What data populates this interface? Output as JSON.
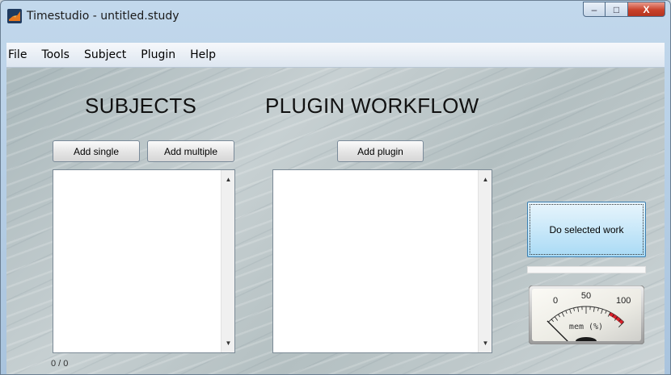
{
  "window": {
    "title": "Timestudio - untitled.study",
    "icon": "matlab-logo-icon",
    "controls": {
      "minimize": "–",
      "maximize": "□",
      "close": "X"
    }
  },
  "menubar": {
    "items": [
      {
        "label": "File"
      },
      {
        "label": "Tools"
      },
      {
        "label": "Subject"
      },
      {
        "label": "Plugin"
      },
      {
        "label": "Help"
      }
    ]
  },
  "subjects": {
    "heading": "SUBJECTS",
    "add_single_label": "Add single",
    "add_multiple_label": "Add multiple",
    "items": [],
    "counter": "0 / 0"
  },
  "workflow": {
    "heading": "PLUGIN WORKFLOW",
    "add_plugin_label": "Add plugin",
    "items": []
  },
  "actions": {
    "do_work_label": "Do selected work",
    "progress": 0
  },
  "memory_meter": {
    "scale_labels": [
      "0",
      "50",
      "100"
    ],
    "label": "mem (%)",
    "value": 0,
    "redzone_start": 80,
    "colors": {
      "redzone": "#d8202a",
      "needle": "#111111",
      "face": "#f4f2ec"
    }
  },
  "colors": {
    "accent_button": "#a9daf5",
    "titlebar": "#c2d8ec"
  }
}
